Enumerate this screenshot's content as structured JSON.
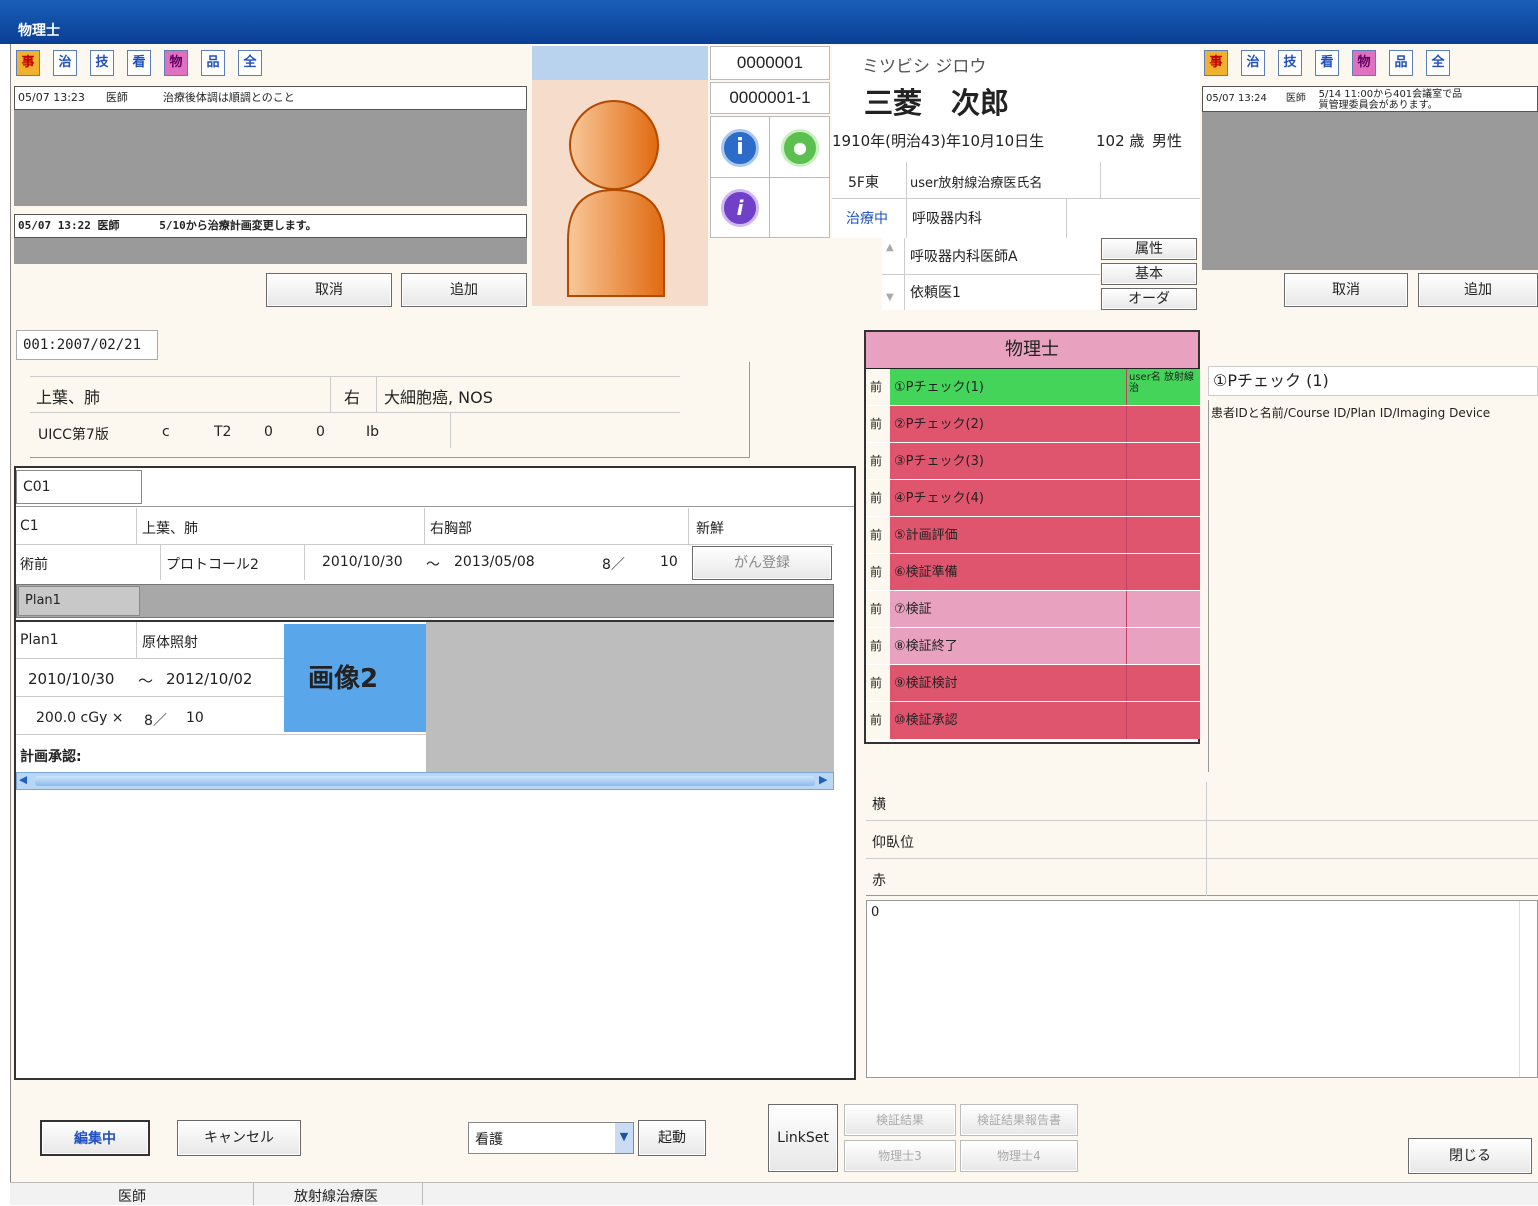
{
  "window": {
    "title": "物理士"
  },
  "categories": [
    "事",
    "治",
    "技",
    "看",
    "物",
    "品",
    "全"
  ],
  "colors": {
    "cat": [
      "#f0b030",
      "#ffffff",
      "#ffffff",
      "#ffffff",
      "#e070c0",
      "#ffffff",
      "#ffffff"
    ],
    "wf_green": "#44d45a",
    "wf_red": "#e0556e",
    "wf_pink": "#e8a2bf"
  },
  "left_memo": {
    "top_entry": {
      "date": "05/07 13:23",
      "author": "医師",
      "text": "治療後体調は順調とのこと"
    },
    "bottom_entry": {
      "date": "05/07 13:22",
      "author": "医師",
      "text": "5/10から治療計画変更します。"
    },
    "cancel": "取消",
    "add": "追加"
  },
  "right_memo": {
    "top_entry": {
      "date": "05/07 13:24",
      "author": "医師",
      "text": "5/14 11:00から401会議室で品質管理委員会があります。"
    },
    "cancel": "取消",
    "add": "追加"
  },
  "patient": {
    "id": "0000001",
    "id_sub": "0000001-1",
    "kana": "ミツビシ ジロウ",
    "name": "三菱　次郎",
    "birth": "1910年(明治43)年10月10日生",
    "age": "102 歳",
    "sex": "男性",
    "ward": "5F東",
    "ward_doctor": "user放射線治療医氏名",
    "status": "治療中",
    "dept": "呼吸器内科",
    "doctor": "呼吸器内科医師A",
    "referrer": "依頼医1",
    "btn_attr": "属性",
    "btn_basic": "基本",
    "btn_order": "オーダ"
  },
  "diagnosis": {
    "tab": "001:2007/02/21",
    "site": "上葉、肺",
    "side": "右",
    "histology": "大細胞癌, NOS",
    "tnm": [
      "UICC第7版",
      "c",
      "T2",
      "0",
      "0",
      "Ib"
    ]
  },
  "course": {
    "tab": "C01",
    "row1": [
      "C1",
      "上葉、肺",
      "右胸部",
      "新鮮"
    ],
    "row2": [
      "術前",
      "プロトコール2",
      "2010/10/30",
      "～",
      "2013/05/08",
      "8／",
      "10"
    ],
    "cancer_reg": "がん登録"
  },
  "plan": {
    "tab": "Plan1",
    "name": "Plan1",
    "method": "原体照射",
    "start": "2010/10/30",
    "tilde": "～",
    "end": "2012/10/02",
    "dose": "200.0 cGy ×",
    "frac": "8／",
    "total": "10",
    "image": "画像2",
    "approval": "計画承認:"
  },
  "workflow": {
    "header": "物理士",
    "items": [
      {
        "pre": "前",
        "label": "①Pチェック(1)",
        "side": "user名 放射線治",
        "state": "green"
      },
      {
        "pre": "前",
        "label": "②Pチェック(2)",
        "side": "",
        "state": "red"
      },
      {
        "pre": "前",
        "label": "③Pチェック(3)",
        "side": "",
        "state": "red"
      },
      {
        "pre": "前",
        "label": "④Pチェック(4)",
        "side": "",
        "state": "red"
      },
      {
        "pre": "前",
        "label": "⑤計画評価",
        "side": "",
        "state": "red"
      },
      {
        "pre": "前",
        "label": "⑥検証準備",
        "side": "",
        "state": "red"
      },
      {
        "pre": "前",
        "label": "⑦検証",
        "side": "",
        "state": "pink"
      },
      {
        "pre": "前",
        "label": "⑧検証終了",
        "side": "",
        "state": "pink"
      },
      {
        "pre": "前",
        "label": "⑨検証検討",
        "side": "",
        "state": "red"
      },
      {
        "pre": "前",
        "label": "⑩検証承認",
        "side": "",
        "state": "red"
      }
    ]
  },
  "detail": {
    "title": "①Pチェック (1)",
    "text": "患者IDと名前/Course ID/Plan ID/Imaging Device"
  },
  "params": [
    "横",
    "仰臥位",
    "赤"
  ],
  "comment": "0",
  "bottom": {
    "editing": "編集中",
    "cancel": "キャンセル",
    "select": "看護",
    "launch": "起動",
    "linkset": "LinkSet",
    "b1": "検証結果",
    "b2": "検証結果報告書",
    "b3": "物理士3",
    "b4": "物理士4",
    "close": "閉じる"
  },
  "status": [
    "医師",
    "放射線治療医"
  ]
}
